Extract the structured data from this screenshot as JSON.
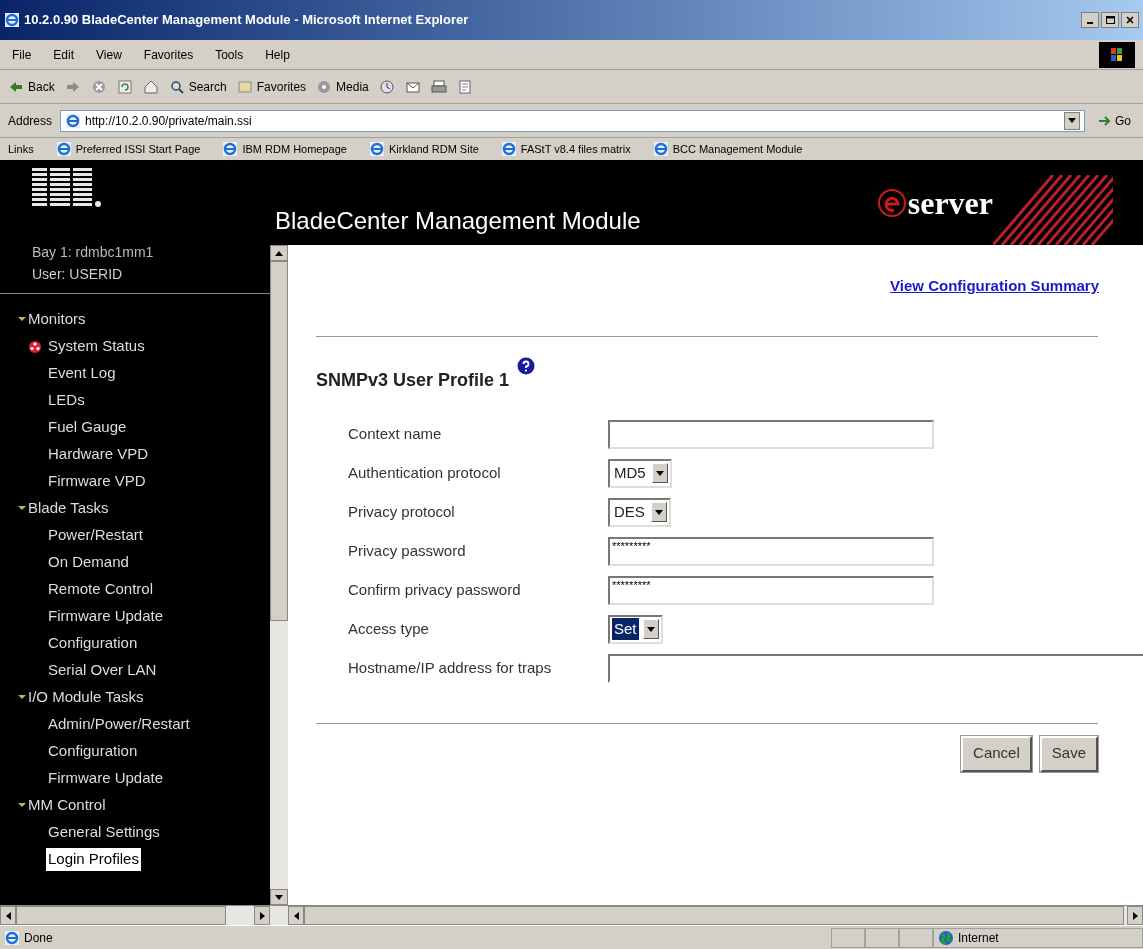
{
  "window": {
    "title": "10.2.0.90 BladeCenter Management Module - Microsoft Internet Explorer"
  },
  "menu": [
    "File",
    "Edit",
    "View",
    "Favorites",
    "Tools",
    "Help"
  ],
  "toolbar": [
    {
      "kind": "back",
      "label": "Back"
    },
    {
      "kind": "forward"
    },
    {
      "kind": "stop"
    },
    {
      "kind": "refresh"
    },
    {
      "kind": "home"
    },
    {
      "kind": "search",
      "label": "Search"
    },
    {
      "kind": "favorites",
      "label": "Favorites"
    },
    {
      "kind": "media",
      "label": "Media"
    },
    {
      "kind": "history"
    },
    {
      "kind": "mail"
    },
    {
      "kind": "print"
    },
    {
      "kind": "edit"
    }
  ],
  "address": {
    "label": "Address",
    "value": "http://10.2.0.90/private/main.ssi",
    "go": "Go"
  },
  "links": {
    "label": "Links",
    "items": [
      "Preferred ISSI Start Page",
      "IBM RDM Homepage",
      "Kirkland RDM Site",
      "FAStT v8.4 files matrix",
      "BCC Management Module"
    ]
  },
  "header": {
    "title": "BladeCenter Management Module",
    "brand": "server"
  },
  "session": {
    "bay": "Bay 1: rdmbc1mm1",
    "user": "User: USERID"
  },
  "sidebar": {
    "items": [
      {
        "label": "Monitors",
        "expanded": true,
        "children": [
          {
            "label": "System Status",
            "alert": true,
            "selected": false
          },
          {
            "label": "Event Log",
            "alert": false,
            "selected": false
          },
          {
            "label": "LEDs",
            "alert": false,
            "selected": false
          },
          {
            "label": "Fuel Gauge",
            "alert": false,
            "selected": false
          },
          {
            "label": "Hardware VPD",
            "alert": false,
            "selected": false
          },
          {
            "label": "Firmware VPD",
            "alert": false,
            "selected": false
          }
        ]
      },
      {
        "label": "Blade Tasks",
        "expanded": true,
        "children": [
          {
            "label": "Power/Restart",
            "alert": false,
            "selected": false
          },
          {
            "label": "On Demand",
            "alert": false,
            "selected": false
          },
          {
            "label": "Remote Control",
            "alert": false,
            "selected": false
          },
          {
            "label": "Firmware Update",
            "alert": false,
            "selected": false
          },
          {
            "label": "Configuration",
            "alert": false,
            "selected": false
          },
          {
            "label": "Serial Over LAN",
            "alert": false,
            "selected": false
          }
        ]
      },
      {
        "label": "I/O Module Tasks",
        "expanded": true,
        "children": [
          {
            "label": "Admin/Power/Restart",
            "alert": false,
            "selected": false
          },
          {
            "label": "Configuration",
            "alert": false,
            "selected": false
          },
          {
            "label": "Firmware Update",
            "alert": false,
            "selected": false
          }
        ]
      },
      {
        "label": "MM Control",
        "expanded": true,
        "children": [
          {
            "label": "General Settings",
            "alert": false,
            "selected": false
          },
          {
            "label": "Login Profiles",
            "alert": false,
            "selected": true
          }
        ]
      }
    ]
  },
  "content": {
    "link": "View Configuration Summary",
    "heading": "SNMPv3 User Profile 1",
    "fields": [
      {
        "label": "Context name",
        "kind": "text",
        "focused": false
      },
      {
        "label": "Authentication protocol",
        "kind": "select",
        "value": "MD5",
        "focused": false
      },
      {
        "label": "Privacy protocol",
        "kind": "select",
        "value": "DES",
        "focused": false
      },
      {
        "label": "Privacy password",
        "kind": "password",
        "value": "*********",
        "focused": false
      },
      {
        "label": "Confirm privacy password",
        "kind": "password",
        "value": "*********",
        "focused": false
      },
      {
        "label": "Access type",
        "kind": "select",
        "value": "Set",
        "focused": true
      },
      {
        "label": "Hostname/IP address for traps",
        "kind": "wide",
        "focused": false
      }
    ],
    "buttons": [
      "Cancel",
      "Save"
    ]
  },
  "status_bar": {
    "text": "Done",
    "zone": "Internet"
  }
}
